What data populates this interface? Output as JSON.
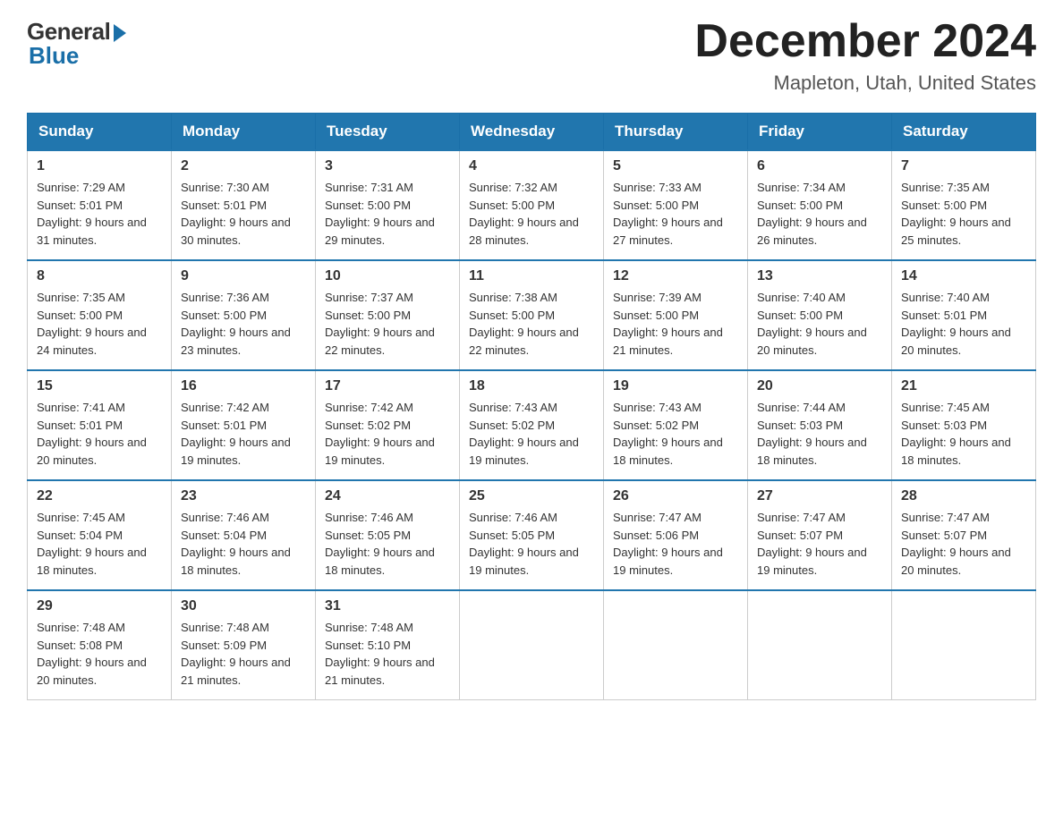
{
  "logo": {
    "general": "General",
    "blue": "Blue"
  },
  "title": {
    "month_year": "December 2024",
    "location": "Mapleton, Utah, United States"
  },
  "days_of_week": [
    "Sunday",
    "Monday",
    "Tuesday",
    "Wednesday",
    "Thursday",
    "Friday",
    "Saturday"
  ],
  "weeks": [
    [
      {
        "day": "1",
        "sunrise": "7:29 AM",
        "sunset": "5:01 PM",
        "daylight": "9 hours and 31 minutes."
      },
      {
        "day": "2",
        "sunrise": "7:30 AM",
        "sunset": "5:01 PM",
        "daylight": "9 hours and 30 minutes."
      },
      {
        "day": "3",
        "sunrise": "7:31 AM",
        "sunset": "5:00 PM",
        "daylight": "9 hours and 29 minutes."
      },
      {
        "day": "4",
        "sunrise": "7:32 AM",
        "sunset": "5:00 PM",
        "daylight": "9 hours and 28 minutes."
      },
      {
        "day": "5",
        "sunrise": "7:33 AM",
        "sunset": "5:00 PM",
        "daylight": "9 hours and 27 minutes."
      },
      {
        "day": "6",
        "sunrise": "7:34 AM",
        "sunset": "5:00 PM",
        "daylight": "9 hours and 26 minutes."
      },
      {
        "day": "7",
        "sunrise": "7:35 AM",
        "sunset": "5:00 PM",
        "daylight": "9 hours and 25 minutes."
      }
    ],
    [
      {
        "day": "8",
        "sunrise": "7:35 AM",
        "sunset": "5:00 PM",
        "daylight": "9 hours and 24 minutes."
      },
      {
        "day": "9",
        "sunrise": "7:36 AM",
        "sunset": "5:00 PM",
        "daylight": "9 hours and 23 minutes."
      },
      {
        "day": "10",
        "sunrise": "7:37 AM",
        "sunset": "5:00 PM",
        "daylight": "9 hours and 22 minutes."
      },
      {
        "day": "11",
        "sunrise": "7:38 AM",
        "sunset": "5:00 PM",
        "daylight": "9 hours and 22 minutes."
      },
      {
        "day": "12",
        "sunrise": "7:39 AM",
        "sunset": "5:00 PM",
        "daylight": "9 hours and 21 minutes."
      },
      {
        "day": "13",
        "sunrise": "7:40 AM",
        "sunset": "5:00 PM",
        "daylight": "9 hours and 20 minutes."
      },
      {
        "day": "14",
        "sunrise": "7:40 AM",
        "sunset": "5:01 PM",
        "daylight": "9 hours and 20 minutes."
      }
    ],
    [
      {
        "day": "15",
        "sunrise": "7:41 AM",
        "sunset": "5:01 PM",
        "daylight": "9 hours and 20 minutes."
      },
      {
        "day": "16",
        "sunrise": "7:42 AM",
        "sunset": "5:01 PM",
        "daylight": "9 hours and 19 minutes."
      },
      {
        "day": "17",
        "sunrise": "7:42 AM",
        "sunset": "5:02 PM",
        "daylight": "9 hours and 19 minutes."
      },
      {
        "day": "18",
        "sunrise": "7:43 AM",
        "sunset": "5:02 PM",
        "daylight": "9 hours and 19 minutes."
      },
      {
        "day": "19",
        "sunrise": "7:43 AM",
        "sunset": "5:02 PM",
        "daylight": "9 hours and 18 minutes."
      },
      {
        "day": "20",
        "sunrise": "7:44 AM",
        "sunset": "5:03 PM",
        "daylight": "9 hours and 18 minutes."
      },
      {
        "day": "21",
        "sunrise": "7:45 AM",
        "sunset": "5:03 PM",
        "daylight": "9 hours and 18 minutes."
      }
    ],
    [
      {
        "day": "22",
        "sunrise": "7:45 AM",
        "sunset": "5:04 PM",
        "daylight": "9 hours and 18 minutes."
      },
      {
        "day": "23",
        "sunrise": "7:46 AM",
        "sunset": "5:04 PM",
        "daylight": "9 hours and 18 minutes."
      },
      {
        "day": "24",
        "sunrise": "7:46 AM",
        "sunset": "5:05 PM",
        "daylight": "9 hours and 18 minutes."
      },
      {
        "day": "25",
        "sunrise": "7:46 AM",
        "sunset": "5:05 PM",
        "daylight": "9 hours and 19 minutes."
      },
      {
        "day": "26",
        "sunrise": "7:47 AM",
        "sunset": "5:06 PM",
        "daylight": "9 hours and 19 minutes."
      },
      {
        "day": "27",
        "sunrise": "7:47 AM",
        "sunset": "5:07 PM",
        "daylight": "9 hours and 19 minutes."
      },
      {
        "day": "28",
        "sunrise": "7:47 AM",
        "sunset": "5:07 PM",
        "daylight": "9 hours and 20 minutes."
      }
    ],
    [
      {
        "day": "29",
        "sunrise": "7:48 AM",
        "sunset": "5:08 PM",
        "daylight": "9 hours and 20 minutes."
      },
      {
        "day": "30",
        "sunrise": "7:48 AM",
        "sunset": "5:09 PM",
        "daylight": "9 hours and 21 minutes."
      },
      {
        "day": "31",
        "sunrise": "7:48 AM",
        "sunset": "5:10 PM",
        "daylight": "9 hours and 21 minutes."
      },
      null,
      null,
      null,
      null
    ]
  ],
  "labels": {
    "sunrise_prefix": "Sunrise: ",
    "sunset_prefix": "Sunset: ",
    "daylight_prefix": "Daylight: "
  }
}
